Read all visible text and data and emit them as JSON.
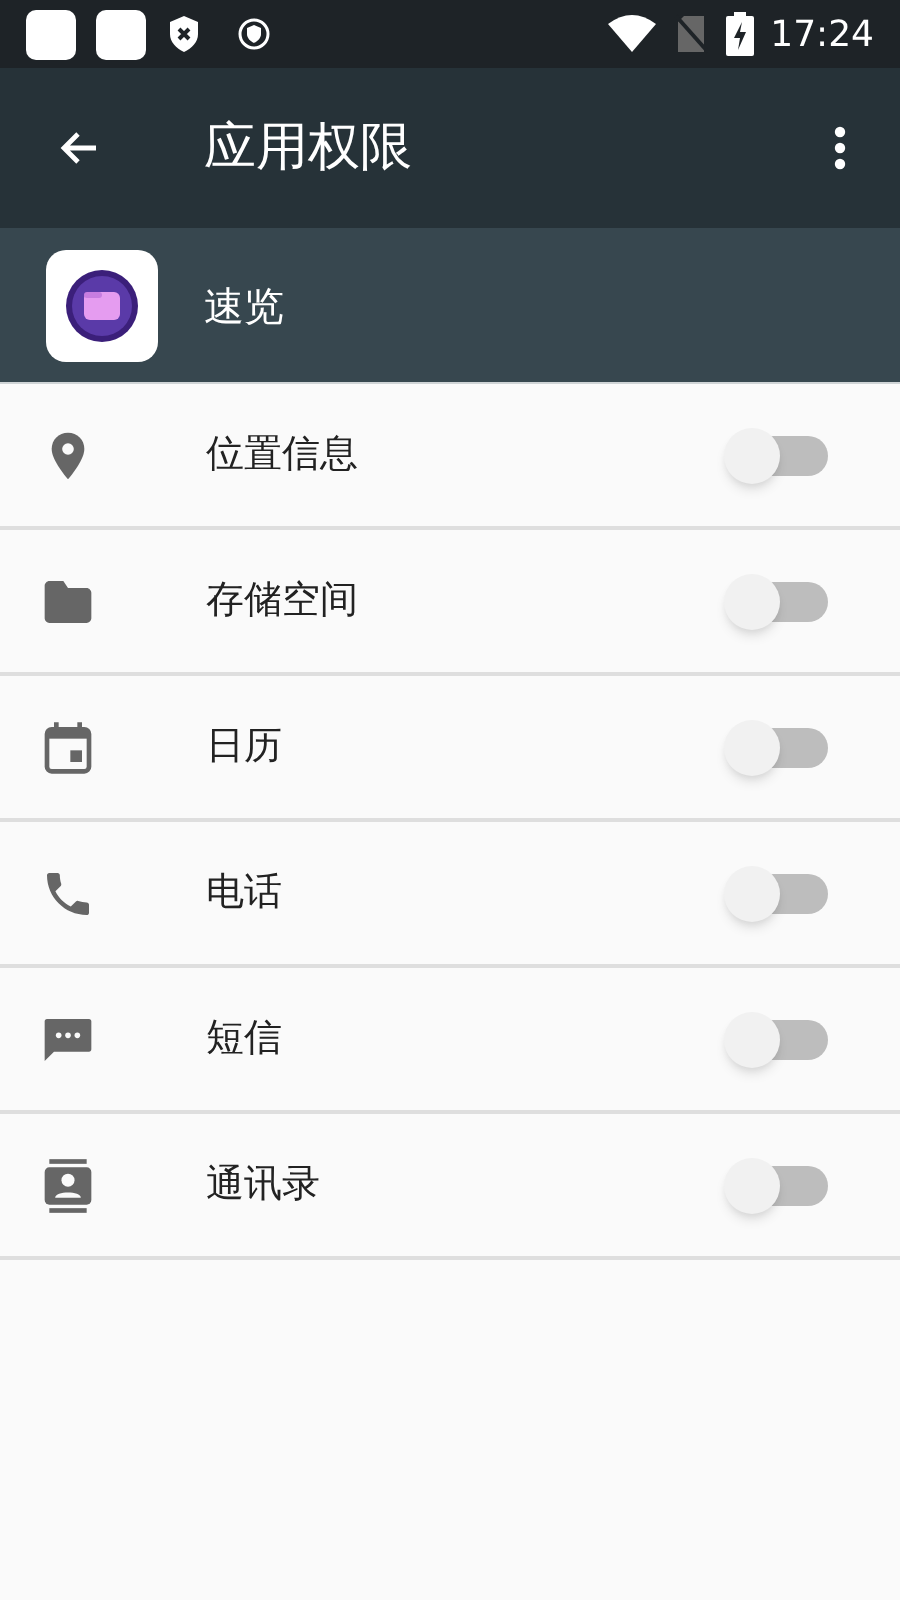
{
  "status_bar": {
    "time": "17:24"
  },
  "app_bar": {
    "title": "应用权限"
  },
  "app": {
    "name": "速览"
  },
  "permissions": [
    {
      "kind": "location",
      "label": "位置信息",
      "on": false
    },
    {
      "kind": "storage",
      "label": "存储空间",
      "on": false
    },
    {
      "kind": "calendar",
      "label": "日历",
      "on": false
    },
    {
      "kind": "phone",
      "label": "电话",
      "on": false
    },
    {
      "kind": "sms",
      "label": "短信",
      "on": false
    },
    {
      "kind": "contacts",
      "label": "通讯录",
      "on": false
    }
  ]
}
